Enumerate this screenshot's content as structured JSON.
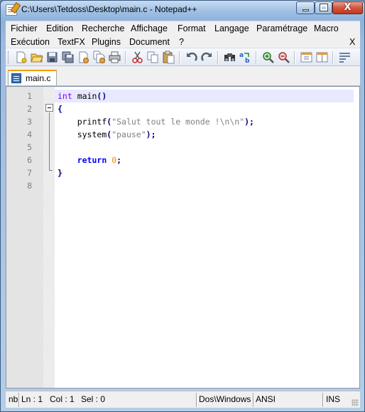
{
  "window": {
    "title": "C:\\Users\\Tetdoss\\Desktop\\main.c - Notepad++",
    "close_glyph": "X"
  },
  "menubar": {
    "row1": [
      "Fichier",
      "Edition",
      "Recherche",
      "Affichage",
      "Format",
      "Langage",
      "Paramétrage",
      "Macro"
    ],
    "row2": [
      "Exécution",
      "TextFX",
      "Plugins",
      "Document",
      "?"
    ],
    "close_doc": "X"
  },
  "toolbar": {
    "icons": [
      "new-file",
      "open-file",
      "save",
      "save-all",
      "close",
      "close-all",
      "print",
      "cut",
      "copy",
      "paste",
      "undo",
      "redo",
      "find",
      "replace",
      "zoom-in",
      "zoom-out",
      "sync-vertical",
      "sync-horizontal",
      "word-wrap"
    ]
  },
  "tabs": [
    {
      "label": "main.c",
      "active": true
    }
  ],
  "editor": {
    "line_numbers": [
      "1",
      "2",
      "3",
      "4",
      "5",
      "6",
      "7",
      "8"
    ],
    "lines": [
      {
        "indent": "",
        "tokens": [
          {
            "t": "int",
            "c": "kw"
          },
          {
            "t": " main",
            "c": ""
          },
          {
            "t": "()",
            "c": "op"
          }
        ]
      },
      {
        "indent": "",
        "tokens": [
          {
            "t": "{",
            "c": "op"
          }
        ]
      },
      {
        "indent": "    ",
        "tokens": [
          {
            "t": "printf",
            "c": ""
          },
          {
            "t": "(",
            "c": "op"
          },
          {
            "t": "\"Salut tout le monde !\\n\\n\"",
            "c": "str"
          },
          {
            "t": ");",
            "c": "op"
          }
        ]
      },
      {
        "indent": "    ",
        "tokens": [
          {
            "t": "system",
            "c": ""
          },
          {
            "t": "(",
            "c": "op"
          },
          {
            "t": "\"pause\"",
            "c": "str"
          },
          {
            "t": ");",
            "c": "op"
          }
        ]
      },
      {
        "indent": "",
        "tokens": []
      },
      {
        "indent": "    ",
        "tokens": [
          {
            "t": "return",
            "c": "kw2"
          },
          {
            "t": " ",
            "c": ""
          },
          {
            "t": "0",
            "c": "num"
          },
          {
            "t": ";",
            "c": "op"
          }
        ]
      },
      {
        "indent": "",
        "tokens": [
          {
            "t": "}",
            "c": "op"
          }
        ]
      },
      {
        "indent": "",
        "tokens": []
      }
    ]
  },
  "statusbar": {
    "chars": "nb",
    "ln": "Ln : 1",
    "col": "Col : 1",
    "sel": "Sel : 0",
    "eol": "Dos\\Windows",
    "encoding": "ANSI",
    "mode": "INS"
  },
  "colors": {
    "keyword": "#8000ff",
    "instruction": "#0000ff",
    "string": "#808080",
    "number": "#ff8000",
    "operator": "#000080",
    "current_line": "#e8e8ff"
  }
}
